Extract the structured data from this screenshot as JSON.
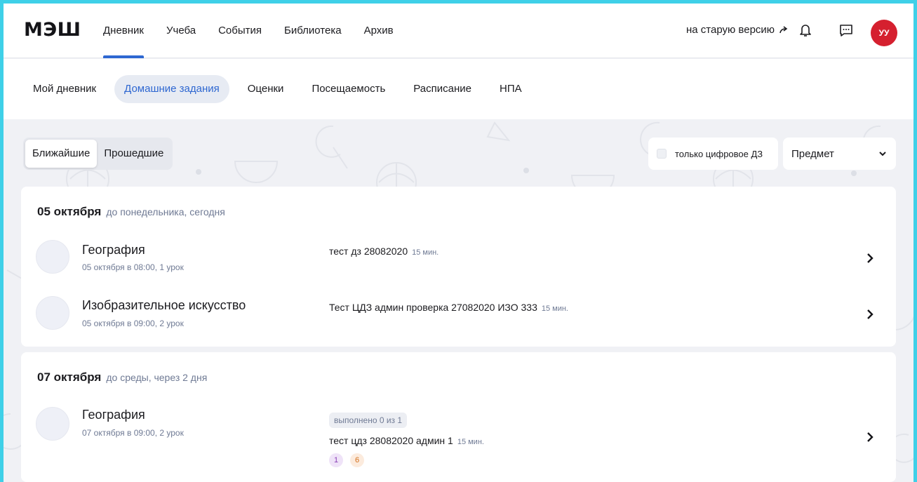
{
  "header": {
    "logo": "МЭШ",
    "nav": [
      {
        "label": "Дневник",
        "active": true
      },
      {
        "label": "Учеба",
        "active": false
      },
      {
        "label": "События",
        "active": false
      },
      {
        "label": "Библиотека",
        "active": false
      },
      {
        "label": "Архив",
        "active": false
      }
    ],
    "old_version_label": "на старую версию",
    "user_initials": "УУ",
    "accent_color": "#2e67d1",
    "avatar_color": "#d5202f"
  },
  "subnav": [
    {
      "label": "Мой дневник",
      "active": false
    },
    {
      "label": "Домашние задания",
      "active": true
    },
    {
      "label": "Оценки",
      "active": false
    },
    {
      "label": "Посещаемость",
      "active": false
    },
    {
      "label": "Расписание",
      "active": false
    },
    {
      "label": "НПА",
      "active": false
    }
  ],
  "filters": {
    "segments": [
      {
        "label": "Ближайшие",
        "active": true
      },
      {
        "label": "Прошедшие",
        "active": false
      }
    ],
    "digital_only_label": "только цифровое ДЗ",
    "digital_only_checked": false,
    "subject_select_value": "Предмет"
  },
  "days": [
    {
      "date": "05 октября",
      "note": "до понедельника, сегодня",
      "items": [
        {
          "subject": "География",
          "time": "05 октября в 08:00, 1 урок",
          "task": "тест дз 28082020",
          "duration": "15 мин."
        },
        {
          "subject": "Изобразительное искусство",
          "time": "05 октября в 09:00, 2 урок",
          "task": "Тест ЦДЗ админ проверка 27082020 ИЗО 333",
          "duration": "15 мин."
        }
      ]
    },
    {
      "date": "07 октября",
      "note": "до среды, через 2 дня",
      "items": [
        {
          "subject": "География",
          "time": "07 октября в 09:00, 2 урок",
          "progress": "выполнено 0 из 1",
          "task": "тест цдз 28082020 админ 1",
          "duration": "15 мин.",
          "marks": [
            "1",
            "6"
          ]
        }
      ]
    }
  ]
}
